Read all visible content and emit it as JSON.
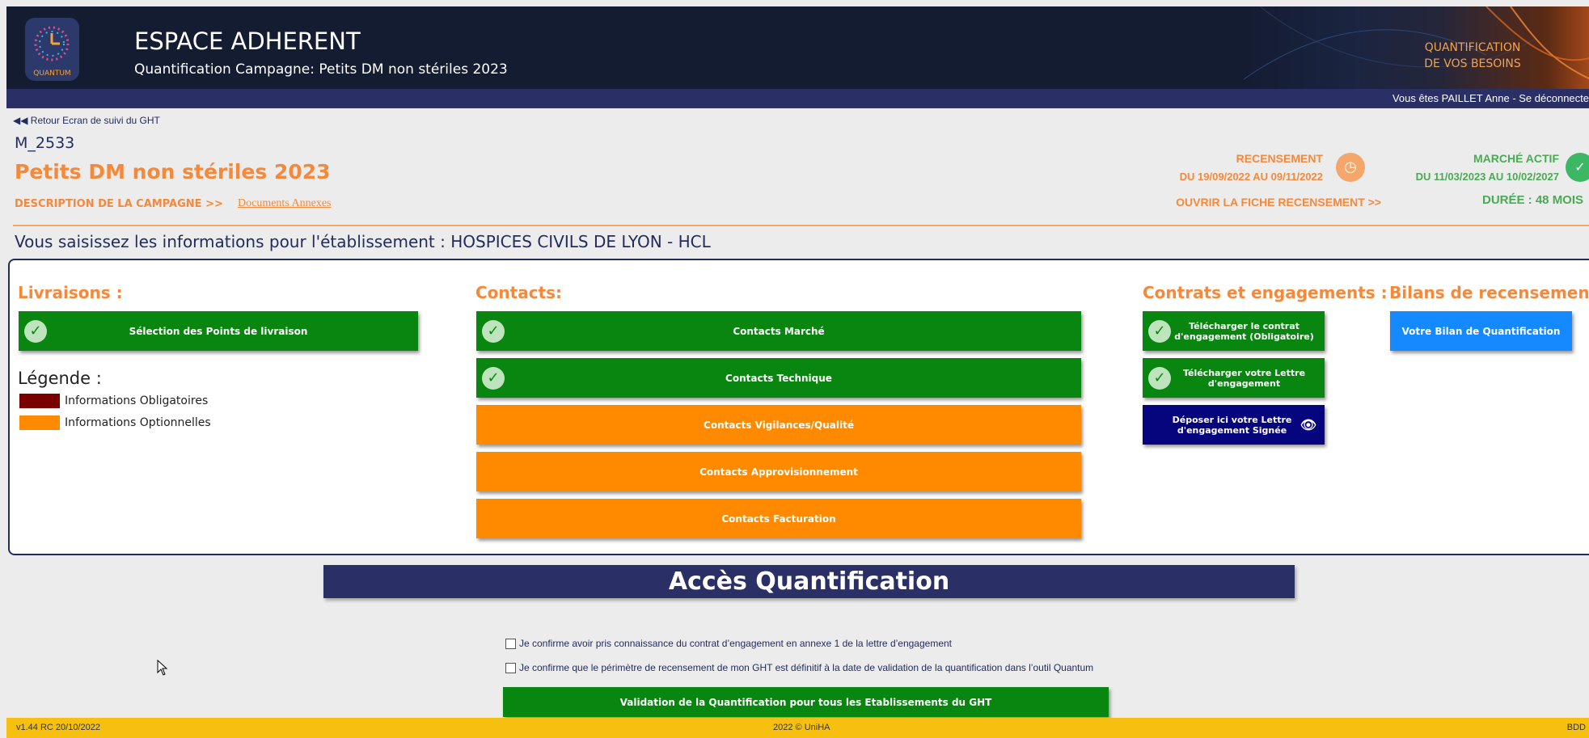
{
  "header": {
    "logo_text": "QUANTUM",
    "title": "ESPACE ADHERENT",
    "subtitle": "Quantification Campagne: Petits DM non stériles 2023",
    "banner_line1": "QUANTIFICATION",
    "banner_line2": "DE VOS BESOINS",
    "banner_amp": "&",
    "user_text": "Vous êtes PAILLET Anne   - Se déconnecte"
  },
  "nav": {
    "back_link": "◀◀ Retour Ecran de suivi du GHT"
  },
  "campaign": {
    "code": "M_2533",
    "title": "Petits DM non stériles 2023",
    "description_link": "DESCRIPTION DE LA CAMPAGNE >>",
    "annexes_link": "Documents Annexes",
    "recensement_label": "RECENSEMENT",
    "recensement_dates": "DU 19/09/2022 AU 09/11/2022",
    "open_fiche_link": "OUVRIR LA FICHE RECENSEMENT >>",
    "marche_label": "MARCHÉ ACTIF",
    "marche_dates": "DU 11/03/2023 AU 10/02/2027",
    "duree": "DURÉE : 48 MOIS",
    "etablissement": "Vous saisissez les informations pour l'établissement : HOSPICES CIVILS DE LYON - HCL"
  },
  "livraisons": {
    "title": "Livraisons :",
    "button": "Sélection des Points de livraison"
  },
  "legende": {
    "title": "Légende :",
    "obligatoires": "Informations Obligatoires",
    "optionnelles": "Informations Optionnelles",
    "color_obligatoire": "#7a0000",
    "color_optionnelle": "#ff8a00"
  },
  "contacts": {
    "title": "Contacts:",
    "items": [
      "Contacts Marché",
      "Contacts Technique",
      "Contacts Vigilances/Qualité",
      "Contacts Approvisionnement",
      "Contacts Facturation"
    ]
  },
  "contrats": {
    "title": "Contrats et engagements :",
    "download_contract": "Télécharger le contrat d'engagement (Obligatoire)",
    "download_letter": "Télécharger votre Lettre d'engagement",
    "upload_letter": "Déposer ici votre Lettre d'engagement Signée"
  },
  "bilans": {
    "title": "Bilans de recensement :",
    "button": "Votre Bilan de Quantification"
  },
  "acces": {
    "title": "Accès Quantification",
    "check1": "Je confirme avoir pris connaissance du contrat d’engagement en annexe 1 de la lettre d’engagement",
    "check2": "Je confirme que le périmètre de recensement de mon GHT est définitif à la date de validation de la quantification dans l’outil Quantum",
    "validate_button": "Validation de la Quantification pour tous les Etablissements du GHT"
  },
  "footer": {
    "version": "v1.44 RC 20/10/2022",
    "copyright": "2022 © UniHA",
    "right": "BDD"
  }
}
